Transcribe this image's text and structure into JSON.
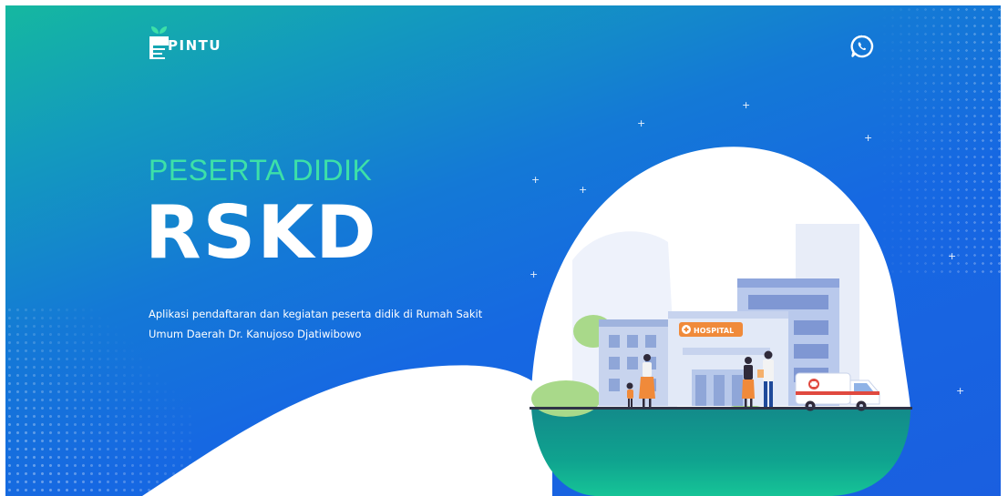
{
  "header": {
    "logo_text": "PINTU",
    "logo_icon": "leaf-pintu-icon",
    "contact_icon": "whatsapp-icon"
  },
  "hero": {
    "subtitle": "PESERTA DIDIK",
    "title": "RSKD",
    "description": "Aplikasi pendaftaran dan kegiatan peserta didik di Rumah Sakit Umum Daerah Dr. Kanujoso Djatiwibowo"
  },
  "illustration": {
    "sign_text": "HOSPITAL"
  },
  "colors": {
    "gradient_start": "#15b8a0",
    "gradient_end": "#1a5fe0",
    "subtitle_color": "#3de0a8",
    "text": "#ffffff",
    "hospital_sign": "#f08a3a"
  }
}
